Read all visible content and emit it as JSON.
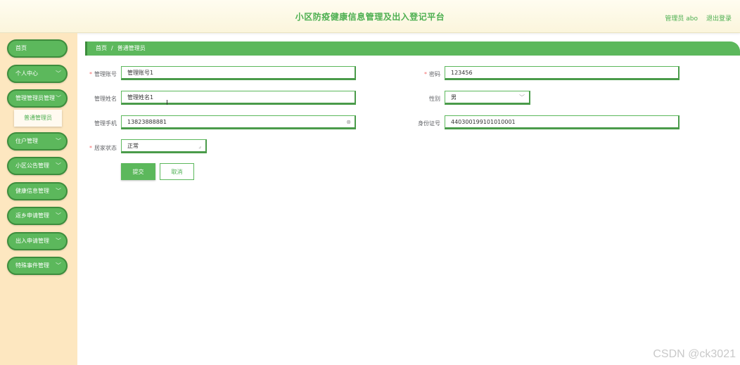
{
  "header": {
    "title": "小区防疫健康信息管理及出入登记平台",
    "user": "管理员 abo",
    "logout": "退出登录"
  },
  "sidebar": {
    "items": [
      {
        "label": "首页",
        "has_chevron": false
      },
      {
        "label": "个人中心",
        "has_chevron": true
      },
      {
        "label": "管理管理员管理",
        "has_chevron": true
      },
      {
        "label": "住户管理",
        "has_chevron": true
      },
      {
        "label": "小区公告管理",
        "has_chevron": true
      },
      {
        "label": "健康信息管理",
        "has_chevron": true
      },
      {
        "label": "返乡申请管理",
        "has_chevron": true
      },
      {
        "label": "出入申请管理",
        "has_chevron": true
      },
      {
        "label": "特殊事件管理",
        "has_chevron": true
      }
    ],
    "submenu": "普通管理员"
  },
  "breadcrumb": {
    "home": "首页",
    "separator": "/",
    "current": "普通管理员"
  },
  "form": {
    "account": {
      "label": "管理账号",
      "value": "管理账号1"
    },
    "password": {
      "label": "密码",
      "value": "123456"
    },
    "name": {
      "label": "管理姓名",
      "value": "管理姓名1"
    },
    "gender": {
      "label": "性别",
      "value": "男"
    },
    "phone": {
      "label": "管理手机",
      "value": "13823888881"
    },
    "idcard": {
      "label": "身份证号",
      "value": "440300199101010001"
    },
    "status": {
      "label": "居家状态",
      "value": "正常"
    },
    "submit": "提交",
    "cancel": "取消"
  },
  "watermark": "CSDN @ck3021"
}
